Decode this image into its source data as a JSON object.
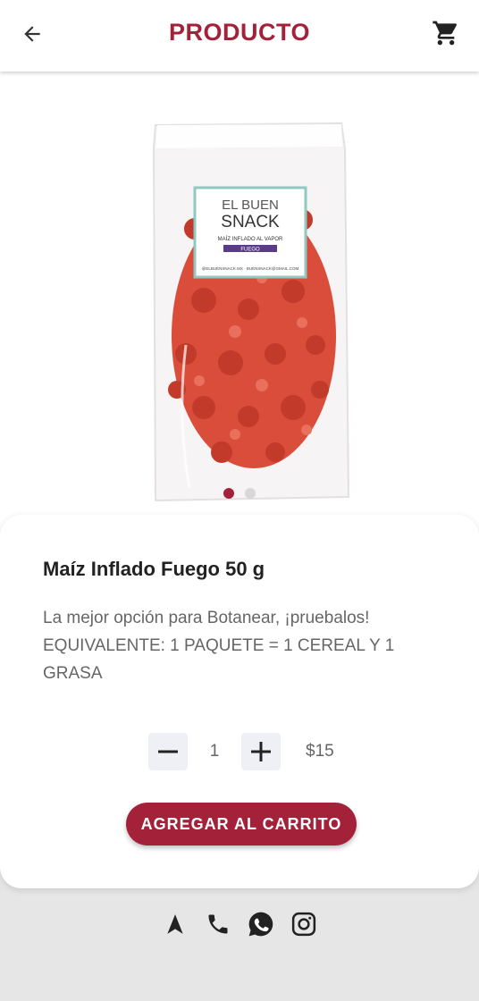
{
  "header": {
    "title": "PRODUCTO",
    "back_icon": "arrow-left-icon",
    "cart_icon": "shopping-cart-icon"
  },
  "product_image": {
    "label": {
      "brand_line1": "EL BUEN",
      "brand_line2": "SNACK",
      "subtitle": "MAÍZ INFLADO AL VAPOR",
      "flavor": "FUEGO",
      "footer": "@ELBUENSNACK.MX · BUENSNACK@GMAIL.COM"
    },
    "carousel": {
      "count": 2,
      "active_index": 0
    }
  },
  "product": {
    "name": "Maíz Inflado Fuego 50 g",
    "description": "La mejor opción para Botanear, ¡pruebalos! EQUIVALENTE: 1 PAQUETE = 1 CEREAL Y 1 GRASA",
    "quantity": "1",
    "price": "$15",
    "add_to_cart_label": "AGREGAR AL CARRITO"
  },
  "social": [
    "navigation-icon",
    "phone-icon",
    "whatsapp-icon",
    "instagram-icon"
  ],
  "colors": {
    "accent": "#a3223a",
    "background": "#e6e6e6",
    "card": "#ffffff"
  }
}
